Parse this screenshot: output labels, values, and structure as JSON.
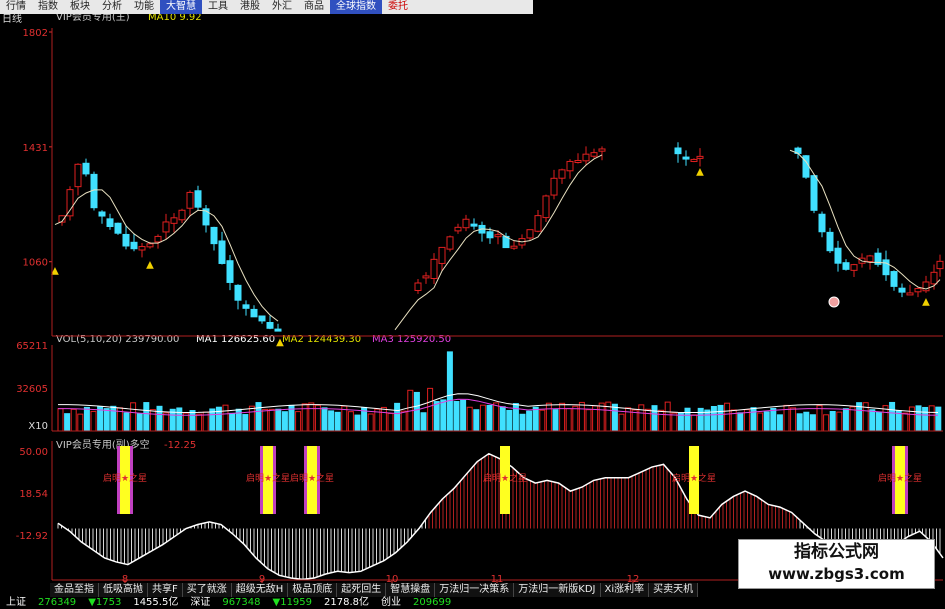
{
  "menu": [
    {
      "label": "行情"
    },
    {
      "label": "指数"
    },
    {
      "label": "板块"
    },
    {
      "label": "分析"
    },
    {
      "label": "功能"
    },
    {
      "label": "大智慧",
      "hl": true
    },
    {
      "label": "工具"
    },
    {
      "label": "港股"
    },
    {
      "label": "外汇"
    },
    {
      "label": "商品"
    },
    {
      "label": "全球指数",
      "hl": true
    },
    {
      "label": "委托",
      "red": true
    }
  ],
  "main_panel": {
    "period": "日线",
    "legend_name": "VIP会员专用(主)",
    "legend_ma": "MA10 9.92"
  },
  "vol_panel": {
    "legend": [
      {
        "text": "VOL(5,10,20) 239790.00",
        "color": "#c8c8c8"
      },
      {
        "text": "MA1 126625.60",
        "color": "#ffffff"
      },
      {
        "text": "MA2 124439.30",
        "color": "#e0e000"
      },
      {
        "text": "MA3 125920.50",
        "color": "#e040e0"
      }
    ],
    "unit": "X10"
  },
  "ind_panel": {
    "legend_name": "VIP会员专用(副)多空",
    "legend_val": "-12.25"
  },
  "chart_data": [
    {
      "type": "candlestick",
      "yticks": [
        1802,
        1431,
        1060
      ],
      "ylim": [
        820,
        1802
      ],
      "xticks": [
        "8",
        "9",
        "10",
        "11",
        "12"
      ]
    },
    {
      "type": "bar",
      "yticks": [
        65211,
        32605
      ],
      "ylim": [
        0,
        65211
      ]
    },
    {
      "type": "area",
      "yticks": [
        50.0,
        18.54,
        -12.92
      ],
      "ylim": [
        -45,
        50
      ],
      "signal_label": "启明★之星",
      "series": [
        {
          "values": [
            -4,
            -10,
            -18,
            -24,
            -30,
            -33,
            -35,
            -30,
            -25,
            -20,
            -14,
            -8,
            -5,
            -3,
            -5,
            -12,
            -20,
            -30,
            -38,
            -43,
            -45,
            -46,
            -45,
            -42,
            -40,
            -41,
            -40,
            -36,
            -32,
            -26,
            -18,
            -8,
            4,
            14,
            22,
            32,
            42,
            48,
            44,
            38,
            30,
            26,
            28,
            26,
            20,
            23,
            28,
            30,
            30,
            30,
            34,
            38,
            40,
            30,
            14,
            2,
            0,
            10,
            16,
            20,
            16,
            10,
            8,
            4,
            -4,
            -12,
            -18,
            -24,
            -30,
            -34,
            -33,
            -28,
            -20,
            -14,
            -10,
            -18,
            -30
          ]
        }
      ]
    }
  ],
  "tabs": [
    "金品至指",
    "低吸高抛",
    "共享F",
    "买了就涨",
    "超级无敌H",
    "极品顶底",
    "起死回生",
    "智慧操盘",
    "万法归一决策系",
    "万法归一新版KDJ",
    "Xi涨利率",
    "买卖天机"
  ],
  "status": [
    {
      "text": "上证",
      "color": "#ffffff"
    },
    {
      "text": "276349",
      "color": "#20e020"
    },
    {
      "text": "▼1753",
      "color": "#20e020"
    },
    {
      "text": "1455.5亿",
      "color": "#ffffff"
    },
    {
      "text": "深证",
      "color": "#ffffff"
    },
    {
      "text": "967348",
      "color": "#20e020"
    },
    {
      "text": "▼11959",
      "color": "#20e020"
    },
    {
      "text": "2178.8亿",
      "color": "#ffffff"
    },
    {
      "text": "创业",
      "color": "#ffffff"
    },
    {
      "text": "209699",
      "color": "#20e020"
    }
  ],
  "watermark": {
    "line1": "指标公式网",
    "line2": "www.zbgs3.com"
  }
}
